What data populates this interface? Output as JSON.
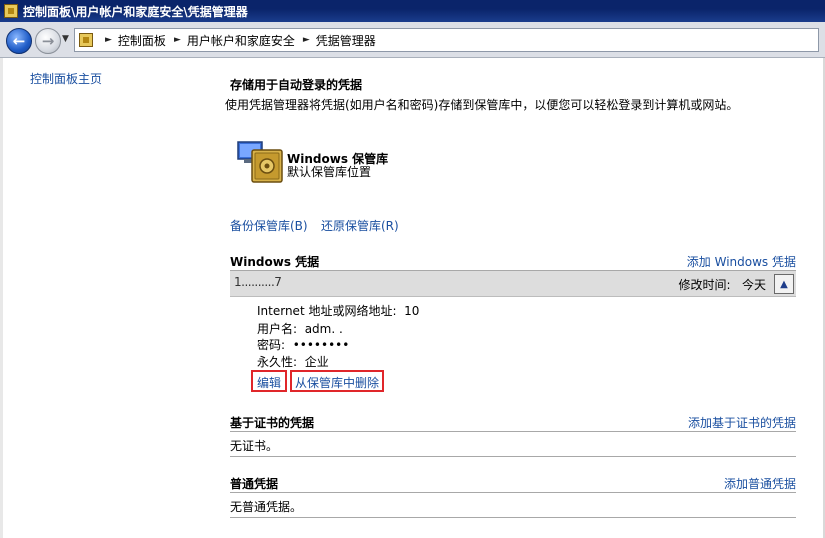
{
  "window": {
    "title": "控制面板\\用户帐户和家庭安全\\凭据管理器"
  },
  "address": {
    "crumbs": [
      "控制面板",
      "用户帐户和家庭安全",
      "凭据管理器"
    ]
  },
  "left": {
    "home_link": "控制面板主页"
  },
  "main": {
    "title": "存储用于自动登录的凭据",
    "description": "使用凭据管理器将凭据(如用户名和密码)存储到保管库中，以便您可以轻松登录到计算机或网站。",
    "vault": {
      "name": "Windows 保管库",
      "subtitle": "默认保管库位置"
    },
    "backup_link": "备份保管库(B)",
    "restore_link": "还原保管库(R)"
  },
  "windows_credentials": {
    "title": "Windows 凭据",
    "add_label": "添加 Windows 凭据",
    "item": {
      "name": "1..........7",
      "modified_label": "修改时间:",
      "modified_value": "今天",
      "address_label": "Internet 地址或网络地址:",
      "address_value": "10",
      "username_label": "用户名:",
      "username_value": "adm.  .",
      "password_label": "密码:",
      "password_value": "••••••••",
      "persistence_label": "永久性:",
      "persistence_value": "企业",
      "edit_label": "编辑",
      "remove_label": "从保管库中删除"
    }
  },
  "certificate_credentials": {
    "title": "基于证书的凭据",
    "add_label": "添加基于证书的凭据",
    "empty_text": "无证书。"
  },
  "generic_credentials": {
    "title": "普通凭据",
    "add_label": "添加普通凭据",
    "empty_text": "无普通凭据。"
  },
  "colors": {
    "link": "#1a4fa0",
    "highlight": "#e0262a",
    "titlebar": "#0a246a"
  }
}
